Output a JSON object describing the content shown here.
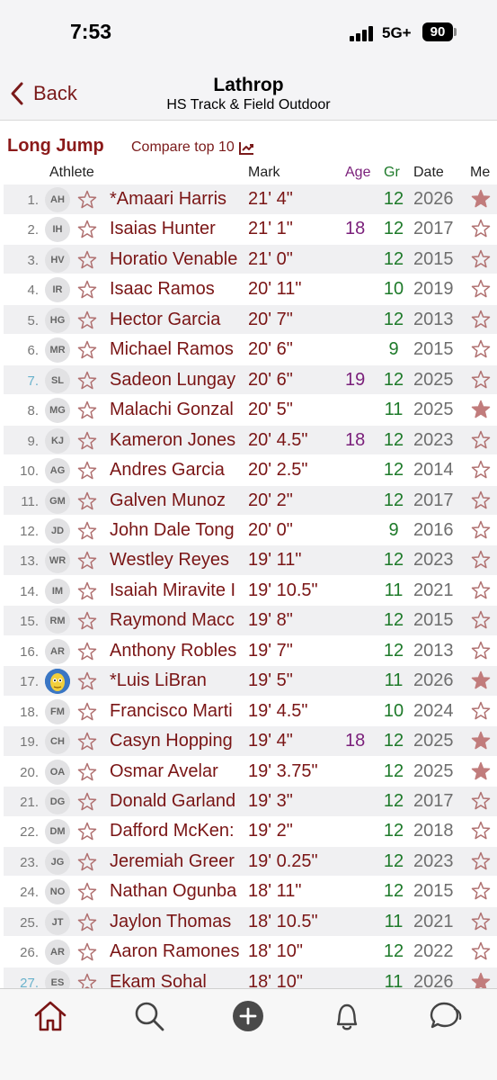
{
  "status_bar": {
    "time": "7:53",
    "network": "5G+",
    "battery": "90"
  },
  "nav": {
    "back_label": "Back",
    "title": "Lathrop",
    "subtitle": "HS Track & Field Outdoor"
  },
  "event": {
    "title": "Long Jump",
    "compare_label": "Compare top 10"
  },
  "columns": {
    "athlete": "Athlete",
    "mark": "Mark",
    "age": "Age",
    "gr": "Gr",
    "date": "Date",
    "me": "Me"
  },
  "colors": {
    "brand": "#7a1515",
    "age": "#7a1f7a",
    "grade": "#1e7a2a",
    "year": "#6e6e6e",
    "medal_filled": "#c17c7c"
  },
  "rows": [
    {
      "rank": "1.",
      "initials": "AH",
      "name": "*Amaari Harris",
      "mark": "21' 4\"",
      "age": "",
      "gr": "12",
      "year": "2026",
      "medal": "filled"
    },
    {
      "rank": "2.",
      "initials": "IH",
      "name": "Isaias Hunter",
      "mark": "21' 1\"",
      "age": "18",
      "gr": "12",
      "year": "2017",
      "medal": "outline"
    },
    {
      "rank": "3.",
      "initials": "HV",
      "name": "Horatio Venable",
      "mark": "21' 0\"",
      "age": "",
      "gr": "12",
      "year": "2015",
      "medal": "outline"
    },
    {
      "rank": "4.",
      "initials": "IR",
      "name": "Isaac Ramos",
      "mark": "20' 11\"",
      "age": "",
      "gr": "10",
      "year": "2019",
      "medal": "outline"
    },
    {
      "rank": "5.",
      "initials": "HG",
      "name": "Hector Garcia",
      "mark": "20' 7\"",
      "age": "",
      "gr": "12",
      "year": "2013",
      "medal": "outline"
    },
    {
      "rank": "6.",
      "initials": "MR",
      "name": "Michael Ramos",
      "mark": "20' 6\"",
      "age": "",
      "gr": "9",
      "year": "2015",
      "medal": "outline"
    },
    {
      "rank": "7.",
      "initials": "SL",
      "name": "Sadeon Lungay",
      "mark": "20' 6\"",
      "age": "19",
      "gr": "12",
      "year": "2025",
      "medal": "outline",
      "rank_light": true
    },
    {
      "rank": "8.",
      "initials": "MG",
      "name": "Malachi Gonzal",
      "mark": "20' 5\"",
      "age": "",
      "gr": "11",
      "year": "2025",
      "medal": "filled"
    },
    {
      "rank": "9.",
      "initials": "KJ",
      "name": "Kameron Jones",
      "mark": "20' 4.5\"",
      "age": "18",
      "gr": "12",
      "year": "2023",
      "medal": "outline"
    },
    {
      "rank": "10.",
      "initials": "AG",
      "name": "Andres Garcia",
      "mark": "20' 2.5\"",
      "age": "",
      "gr": "12",
      "year": "2014",
      "medal": "outline"
    },
    {
      "rank": "11.",
      "initials": "GM",
      "name": "Galven Munoz",
      "mark": "20' 2\"",
      "age": "",
      "gr": "12",
      "year": "2017",
      "medal": "outline"
    },
    {
      "rank": "12.",
      "initials": "JD",
      "name": "John Dale Tong",
      "mark": "20' 0\"",
      "age": "",
      "gr": "9",
      "year": "2016",
      "medal": "outline"
    },
    {
      "rank": "13.",
      "initials": "WR",
      "name": "Westley Reyes",
      "mark": "19' 11\"",
      "age": "",
      "gr": "12",
      "year": "2023",
      "medal": "outline"
    },
    {
      "rank": "14.",
      "initials": "IM",
      "name": "Isaiah Miravite I",
      "mark": "19' 10.5\"",
      "age": "",
      "gr": "11",
      "year": "2021",
      "medal": "outline"
    },
    {
      "rank": "15.",
      "initials": "RM",
      "name": "Raymond Macc",
      "mark": "19' 8\"",
      "age": "",
      "gr": "12",
      "year": "2015",
      "medal": "outline"
    },
    {
      "rank": "16.",
      "initials": "AR",
      "name": "Anthony Robles",
      "mark": "19' 7\"",
      "age": "",
      "gr": "12",
      "year": "2013",
      "medal": "outline"
    },
    {
      "rank": "17.",
      "initials": "",
      "name": "*Luis LiBran",
      "mark": "19' 5\"",
      "age": "",
      "gr": "11",
      "year": "2026",
      "medal": "filled",
      "photo": true
    },
    {
      "rank": "18.",
      "initials": "FM",
      "name": "Francisco Marti",
      "mark": "19' 4.5\"",
      "age": "",
      "gr": "10",
      "year": "2024",
      "medal": "outline"
    },
    {
      "rank": "19.",
      "initials": "CH",
      "name": "Casyn Hopping",
      "mark": "19' 4\"",
      "age": "18",
      "gr": "12",
      "year": "2025",
      "medal": "filled"
    },
    {
      "rank": "20.",
      "initials": "OA",
      "name": "Osmar Avelar",
      "mark": "19' 3.75\"",
      "age": "",
      "gr": "12",
      "year": "2025",
      "medal": "filled"
    },
    {
      "rank": "21.",
      "initials": "DG",
      "name": "Donald Garland",
      "mark": "19' 3\"",
      "age": "",
      "gr": "12",
      "year": "2017",
      "medal": "outline"
    },
    {
      "rank": "22.",
      "initials": "DM",
      "name": "Dafford McKen:",
      "mark": "19' 2\"",
      "age": "",
      "gr": "12",
      "year": "2018",
      "medal": "outline"
    },
    {
      "rank": "23.",
      "initials": "JG",
      "name": "Jeremiah Greer",
      "mark": "19' 0.25\"",
      "age": "",
      "gr": "12",
      "year": "2023",
      "medal": "outline"
    },
    {
      "rank": "24.",
      "initials": "NO",
      "name": "Nathan Ogunba",
      "mark": "18' 11\"",
      "age": "",
      "gr": "12",
      "year": "2015",
      "medal": "outline"
    },
    {
      "rank": "25.",
      "initials": "JT",
      "name": "Jaylon Thomas",
      "mark": "18' 10.5\"",
      "age": "",
      "gr": "11",
      "year": "2021",
      "medal": "outline"
    },
    {
      "rank": "26.",
      "initials": "AR",
      "name": "Aaron Ramones",
      "mark": "18' 10\"",
      "age": "",
      "gr": "12",
      "year": "2022",
      "medal": "outline"
    },
    {
      "rank": "27.",
      "initials": "ES",
      "name": "Ekam Sohal",
      "mark": "18' 10\"",
      "age": "",
      "gr": "11",
      "year": "2026",
      "medal": "filled",
      "rank_light": true
    }
  ],
  "tabs": [
    {
      "name": "home-icon"
    },
    {
      "name": "search-icon"
    },
    {
      "name": "add-icon"
    },
    {
      "name": "bell-icon"
    },
    {
      "name": "chat-icon"
    }
  ]
}
